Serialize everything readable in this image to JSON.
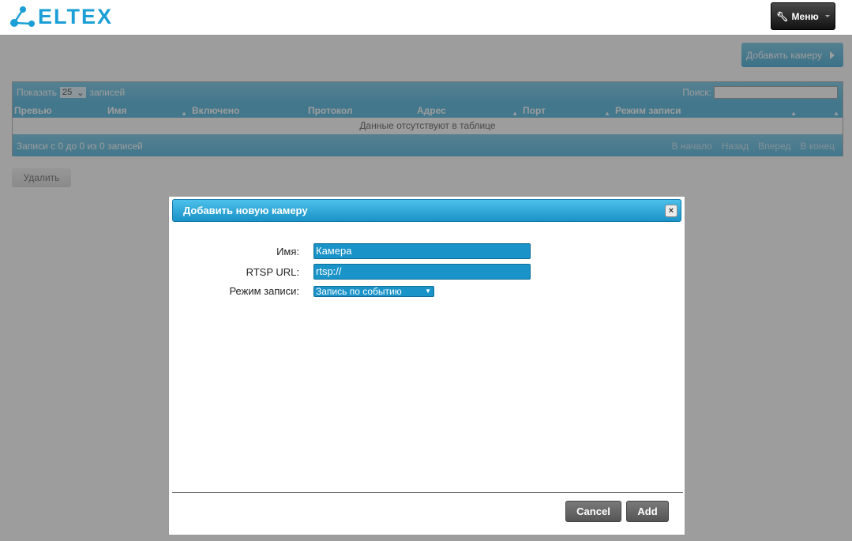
{
  "header": {
    "logo_text": "ELTEX",
    "menu_label": "Меню",
    "colors": {
      "logo": "#1b9fd7",
      "menu_bg": "#222222"
    }
  },
  "toolbar": {
    "add_camera_label": "Добавить камеру"
  },
  "table": {
    "show_prefix": "Показать",
    "page_size": "25",
    "show_suffix": "записей",
    "search_label": "Поиск:",
    "search_value": "",
    "columns": [
      "Превью",
      "Имя",
      "Включено",
      "Протокол",
      "Адрес",
      "Порт",
      "Режим записи",
      ""
    ],
    "empty_text": "Данные отсутствуют в таблице",
    "info": "Записи с 0 до 0 из 0 записей",
    "pager": {
      "first": "В начало",
      "prev": "Назад",
      "next": "Вперед",
      "last": "В конец"
    }
  },
  "delete_label": "Удалить",
  "dialog": {
    "title": "Добавить новую камеру",
    "close_icon": "close-icon",
    "fields": {
      "name_label": "Имя:",
      "name_value": "Камера",
      "url_label": "RTSP URL:",
      "url_value": "rtsp://",
      "mode_label": "Режим записи:",
      "mode_value": "Запись по событию"
    },
    "cancel_label": "Cancel",
    "add_label": "Add",
    "colors": {
      "title_bg": "#1a93c8",
      "input_bg": "#1a93c8"
    }
  }
}
